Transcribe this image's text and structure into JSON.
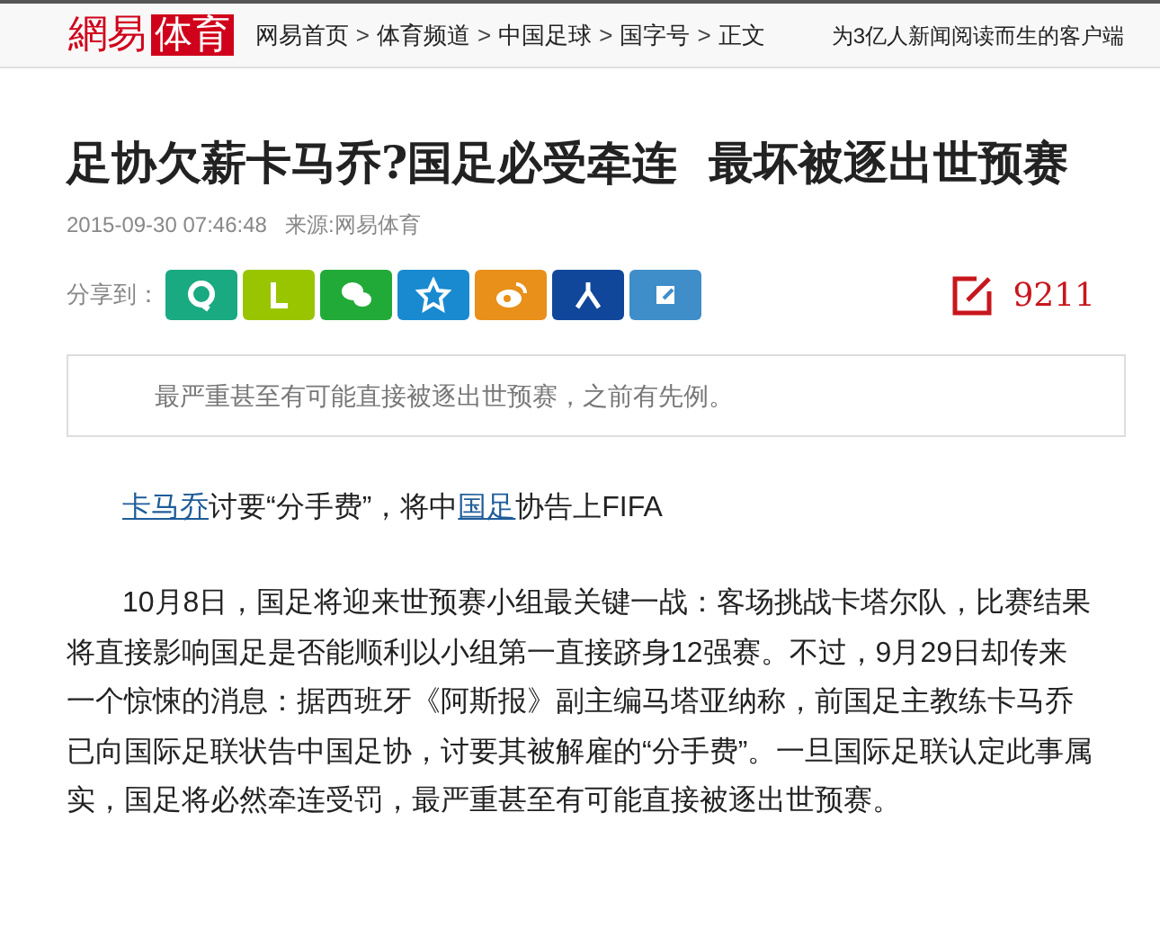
{
  "header": {
    "logo": {
      "brand": "網易",
      "section": "体育"
    },
    "breadcrumbs": [
      "网易首页",
      "体育频道",
      "中国足球",
      "国字号",
      "正文"
    ],
    "separator": ">",
    "tagline": "为3亿人新闻阅读而生的客户端"
  },
  "article": {
    "title": "足协欠薪卡马乔?国足必受牵连  最坏被逐出世预赛",
    "date": "2015-09-30 07:46:48",
    "source": "来源:网易体育",
    "share_label": "分享到：",
    "share_buttons": [
      {
        "color": "#1aaa82"
      },
      {
        "color": "#99c400"
      },
      {
        "color": "#22aa38"
      },
      {
        "color": "#1a8ad0"
      },
      {
        "color": "#e8901a"
      },
      {
        "color": "#10479a"
      },
      {
        "color": "#3f8dc9"
      }
    ],
    "comment_count": "9211",
    "summary": "最严重甚至有可能直接被逐出世预赛，之前有先例。",
    "paragraphs": [
      {
        "kind": "lead",
        "segments": [
          {
            "text": "卡马乔",
            "link": true
          },
          {
            "text": "讨要“分手费”，将中",
            "link": false
          },
          {
            "text": "国足",
            "link": true
          },
          {
            "text": "协告上FIFA",
            "link": false
          }
        ]
      },
      {
        "kind": "body",
        "text": "10月8日，国足将迎来世预赛小组最关键一战：客场挑战卡塔尔队，比赛结果将直接影响国足是否能顺利以小组第一直接跻身12强赛。不过，9月29日却传来一个惊悚的消息：据西班牙《阿斯报》副主编马塔亚纳称，前国足主教练卡马乔已向国际足联状告中国足协，讨要其被解雇的“分手费”。一旦国际足联认定此事属实，国足将必然牵连受罚，最严重甚至有可能直接被逐出世预赛。"
      }
    ]
  }
}
